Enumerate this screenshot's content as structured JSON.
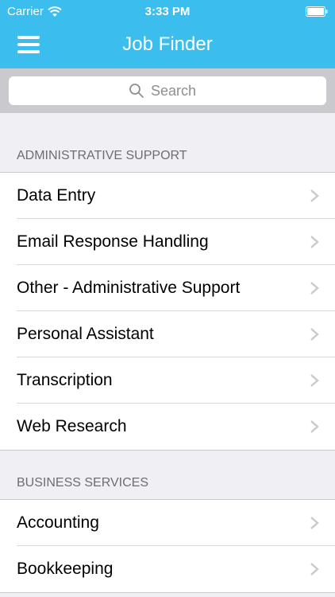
{
  "status_bar": {
    "carrier": "Carrier",
    "time": "3:33 PM",
    "wifi_icon": "wifi-icon",
    "battery_icon": "battery-icon"
  },
  "nav": {
    "title": "Job Finder",
    "menu_icon": "hamburger-menu-icon"
  },
  "search": {
    "placeholder": "Search",
    "icon": "search-icon"
  },
  "sections": [
    {
      "header": "ADMINISTRATIVE SUPPORT",
      "items": [
        "Data Entry",
        "Email Response Handling",
        "Other - Administrative Support",
        "Personal Assistant",
        "Transcription",
        "Web Research"
      ]
    },
    {
      "header": "BUSINESS SERVICES",
      "items": [
        "Accounting",
        "Bookkeeping"
      ]
    }
  ],
  "colors": {
    "nav_background": "#3bbdee",
    "page_background": "#efeff4",
    "search_bar_background": "#c9c9ce",
    "section_header_text": "#6d6d72",
    "chevron": "#c7c7cc"
  }
}
